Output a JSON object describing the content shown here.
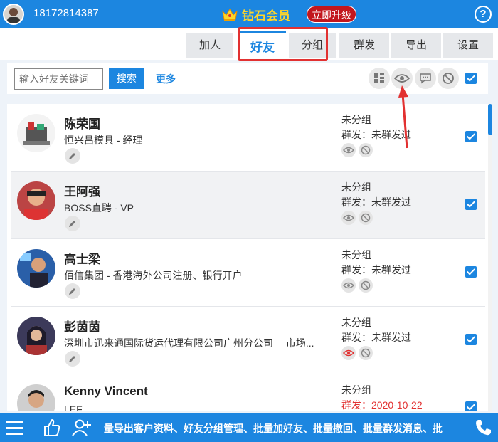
{
  "header": {
    "phone": "18172814387",
    "vip_label": "钻石会员",
    "upgrade_label": "立即升级",
    "help_label": "?"
  },
  "tabs": [
    {
      "label": "加人",
      "active": false
    },
    {
      "label": "好友",
      "active": true
    },
    {
      "label": "分组",
      "active": false
    },
    {
      "label": "群发",
      "active": false
    },
    {
      "label": "导出",
      "active": false
    },
    {
      "label": "设置",
      "active": false
    }
  ],
  "toolbar": {
    "search_placeholder": "输入好友关键词",
    "search_label": "搜索",
    "more_label": "更多",
    "icons": [
      "grid-icon",
      "eye-icon",
      "chat-icon",
      "block-icon"
    ],
    "select_all": true
  },
  "friends": [
    {
      "name": "陈荣国",
      "company": "恒兴昌模具 - 经理",
      "group": "未分组",
      "bulk": "群发：未群发过",
      "bulk_red": false,
      "eye_red": false,
      "checked": true
    },
    {
      "name": "王阿强",
      "company": "BOSS直聘 - VP",
      "group": "未分组",
      "bulk": "群发：未群发过",
      "bulk_red": false,
      "eye_red": false,
      "checked": true
    },
    {
      "name": "高士梁",
      "company": "佰信集团 - 香港海外公司注册、银行开户",
      "group": "未分组",
      "bulk": "群发：未群发过",
      "bulk_red": false,
      "eye_red": false,
      "checked": true
    },
    {
      "name": "彭茵茵",
      "company": "深圳市迅来通国际货运代理有限公司广州分公司— 市场...",
      "group": "未分组",
      "bulk": "群发：未群发过",
      "bulk_red": false,
      "eye_red": true,
      "checked": true
    },
    {
      "name": "Kenny Vincent",
      "company": "LEF",
      "group": "未分组",
      "bulk": "群发：2020-10-22",
      "bulk_red": true,
      "eye_red": false,
      "checked": true
    }
  ],
  "footer": {
    "marquee": "量导出客户资料、好友分组管理、批量加好友、批量撤回、批量群发消息、批",
    "icons": [
      "menu-icon",
      "thumbs-up-icon",
      "add-user-icon",
      "phone-icon"
    ]
  },
  "colors": {
    "primary": "#1c86e0",
    "accent_red": "#e23131",
    "vip_gold": "#ffd52a"
  }
}
